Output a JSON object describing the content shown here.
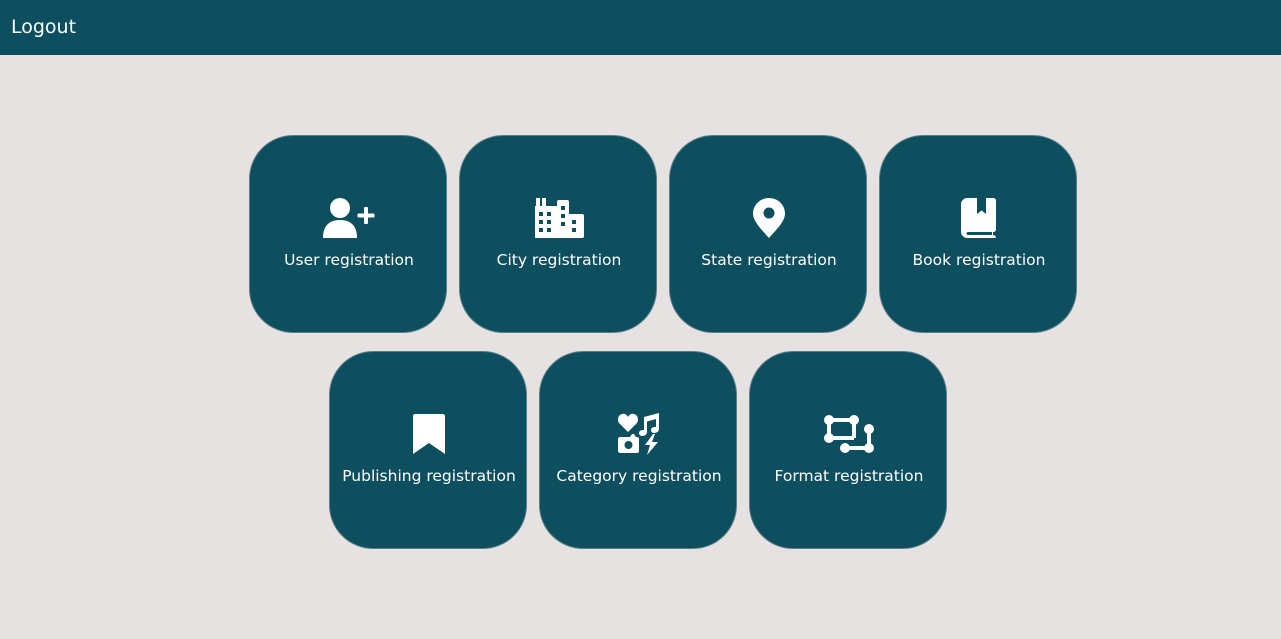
{
  "header": {
    "logout_label": "Logout"
  },
  "cards": [
    {
      "label": "User registration",
      "icon": "user-plus-icon"
    },
    {
      "label": "City registration",
      "icon": "city-icon"
    },
    {
      "label": "State registration",
      "icon": "location-pin-icon"
    },
    {
      "label": "Book registration",
      "icon": "book-bookmark-icon"
    },
    {
      "label": "Publishing registration",
      "icon": "bookmark-icon"
    },
    {
      "label": "Category registration",
      "icon": "icons-category-icon"
    },
    {
      "label": "Format registration",
      "icon": "vector-square-icon"
    }
  ],
  "colors": {
    "primary": "#0d4f5e",
    "background": "#e6e2e1",
    "text": "#ffffff"
  }
}
